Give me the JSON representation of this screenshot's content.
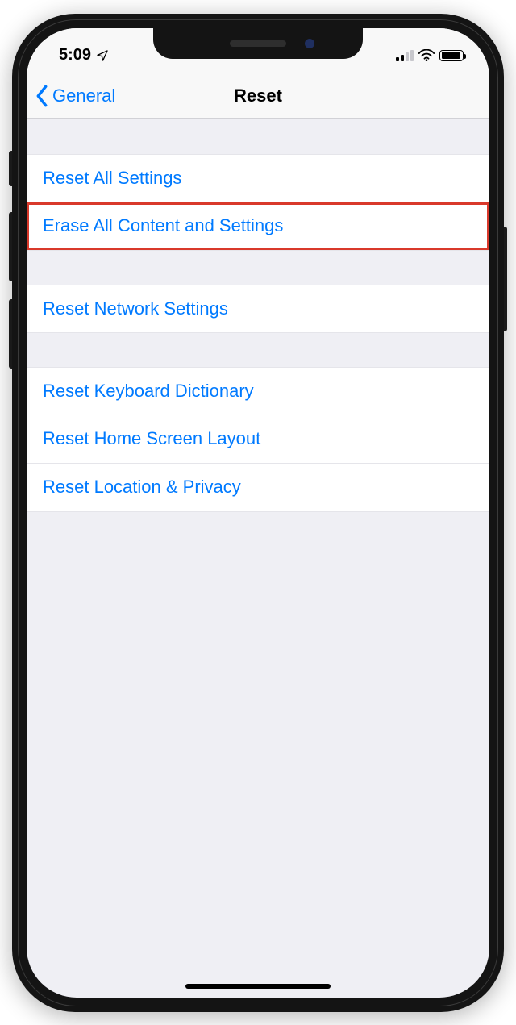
{
  "status": {
    "time": "5:09"
  },
  "nav": {
    "back_label": "General",
    "title": "Reset"
  },
  "groups": [
    {
      "rows": [
        {
          "label": "Reset All Settings",
          "highlight": false
        },
        {
          "label": "Erase All Content and Settings",
          "highlight": true
        }
      ]
    },
    {
      "rows": [
        {
          "label": "Reset Network Settings",
          "highlight": false
        }
      ]
    },
    {
      "rows": [
        {
          "label": "Reset Keyboard Dictionary",
          "highlight": false
        },
        {
          "label": "Reset Home Screen Layout",
          "highlight": false
        },
        {
          "label": "Reset Location & Privacy",
          "highlight": false
        }
      ]
    }
  ]
}
